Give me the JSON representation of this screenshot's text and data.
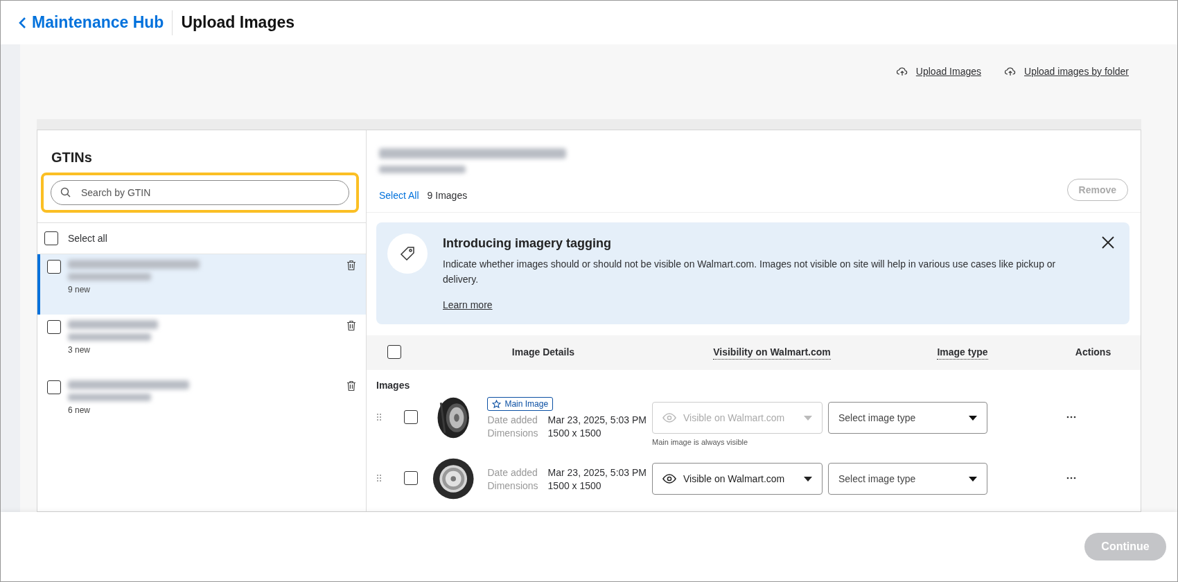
{
  "header": {
    "back_link": "Maintenance Hub",
    "title": "Upload Images"
  },
  "upload_links": [
    "Upload Images",
    "Upload images by folder"
  ],
  "gtin_panel": {
    "title": "GTINs",
    "search": {
      "placeholder": "Search by GTIN",
      "highlighted": true
    },
    "select_all": {
      "label": "Select all",
      "checked": false
    },
    "items": [
      {
        "count": "9 new",
        "selected": true,
        "checked": false
      },
      {
        "count": "3 new",
        "selected": false,
        "checked": false
      },
      {
        "count": "6 new",
        "selected": false,
        "checked": false
      }
    ]
  },
  "detail": {
    "select_all": "Select All",
    "image_count": "9 Images",
    "remove_button": {
      "label": "Remove",
      "disabled": true
    },
    "banner": {
      "title": "Introducing imagery tagging",
      "text": "Indicate whether images should or should not be visible on Walmart.com. Images not visible on site will help in various use cases like pickup or delivery.",
      "link": "Learn more"
    },
    "table": {
      "header_checked": false,
      "columns": [
        {
          "label": "Image Details",
          "dotted": false
        },
        {
          "label": "Visibility on Walmart.com",
          "dotted": true
        },
        {
          "label": "Image type",
          "dotted": true
        },
        {
          "label": "Actions",
          "dotted": false
        }
      ],
      "group": "Images",
      "rows": [
        {
          "checked": false,
          "badge": "Main Image",
          "date_label": "Date added",
          "date": "Mar 23, 2025, 5:03 PM",
          "dim_label": "Dimensions",
          "dimensions": "1500 x 1500",
          "visibility": {
            "value": "Visible on Walmart.com",
            "disabled": true,
            "note": "Main image is always visible"
          },
          "image_type": {
            "placeholder": "Select image type"
          }
        },
        {
          "checked": false,
          "date_label": "Date added",
          "date": "Mar 23, 2025, 5:03 PM",
          "dim_label": "Dimensions",
          "dimensions": "1500 x 1500",
          "visibility": {
            "value": "Visible on Walmart.com",
            "disabled": false
          },
          "image_type": {
            "placeholder": "Select image type"
          }
        }
      ]
    }
  },
  "footer": {
    "continue_button": {
      "label": "Continue",
      "disabled": true
    }
  }
}
